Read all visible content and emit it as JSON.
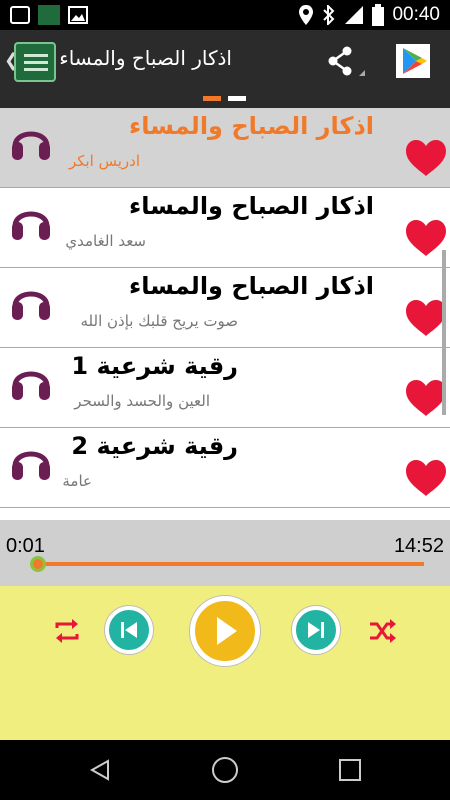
{
  "status_bar": {
    "time": "00:40",
    "icons": [
      "notification-app-icon",
      "notification-app-icon-2",
      "image-icon",
      "location-icon",
      "bluetooth-icon",
      "signal-icon",
      "battery-icon"
    ]
  },
  "action_bar": {
    "title": "اذكار الصباح والمساء",
    "icons": [
      "app-logo",
      "share-icon",
      "play-store-icon"
    ]
  },
  "list": {
    "items": [
      {
        "title": "اذكار الصباح والمساء",
        "subtitle": "ادريس ابكر",
        "selected": true
      },
      {
        "title": "اذكار الصباح والمساء",
        "subtitle": "سعد الغامدي",
        "selected": false
      },
      {
        "title": "اذكار الصباح والمساء",
        "subtitle": "صوت يريح قلبك بإذن الله",
        "selected": false
      },
      {
        "title": "رقية شرعية 1",
        "subtitle": "العين والحسد والسحر",
        "selected": false
      },
      {
        "title": "رقية شرعية 2",
        "subtitle": "عامة",
        "selected": false
      }
    ]
  },
  "player": {
    "current_time": "0:01",
    "total_time": "14:52",
    "progress_fraction": 0.001
  },
  "colors": {
    "accent": "#f07a2a",
    "heart": "#e8173a",
    "headphones": "#6b1e52",
    "player_bg": "#f0ee7e",
    "teal": "#22b3a3",
    "play": "#f2b91a"
  }
}
